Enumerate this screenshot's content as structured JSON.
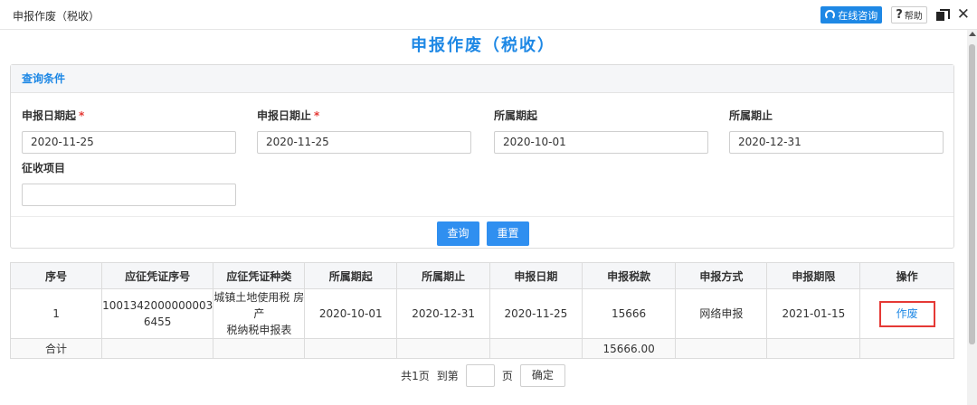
{
  "window": {
    "title": "申报作废（税收）"
  },
  "toolbar": {
    "online_label": "在线咨询",
    "help_q": "?",
    "help_label": "帮助",
    "close_glyph": "✕"
  },
  "page": {
    "title": "申报作废（税收）"
  },
  "query": {
    "heading": "查询条件",
    "fields": [
      {
        "label": "申报日期起",
        "required": "*",
        "value": "2020-11-25"
      },
      {
        "label": "申报日期止",
        "required": "*",
        "value": "2020-11-25"
      },
      {
        "label": "所属期起",
        "value": "2020-10-01"
      },
      {
        "label": "所属期止",
        "value": "2020-12-31"
      },
      {
        "label": "征收项目",
        "value": ""
      }
    ],
    "search_label": "查询",
    "reset_label": "重置"
  },
  "table": {
    "headers": [
      "序号",
      "应征凭证序号",
      "应征凭证种类",
      "所属期起",
      "所属期止",
      "申报日期",
      "申报税款",
      "申报方式",
      "申报期限",
      "操作"
    ],
    "rows": [
      {
        "seq": "1",
        "voucher_no_1": "1001342000000003",
        "voucher_no_2": "6455",
        "voucher_type_1": "城镇土地使用税 房产",
        "voucher_type_2": "税纳税申报表",
        "period_start": "2020-10-01",
        "period_end": "2020-12-31",
        "declare_date": "2020-11-25",
        "tax": "15666",
        "method": "网络申报",
        "deadline": "2021-01-15",
        "action": "作废"
      }
    ],
    "footer": {
      "label": "合计",
      "total": "15666.00"
    }
  },
  "pager": {
    "total_pages": "共1页",
    "goto": "到第",
    "page_unit": "页",
    "confirm": "确定"
  },
  "colors": {
    "accent": "#1e88e5",
    "highlight": "#e53935"
  }
}
